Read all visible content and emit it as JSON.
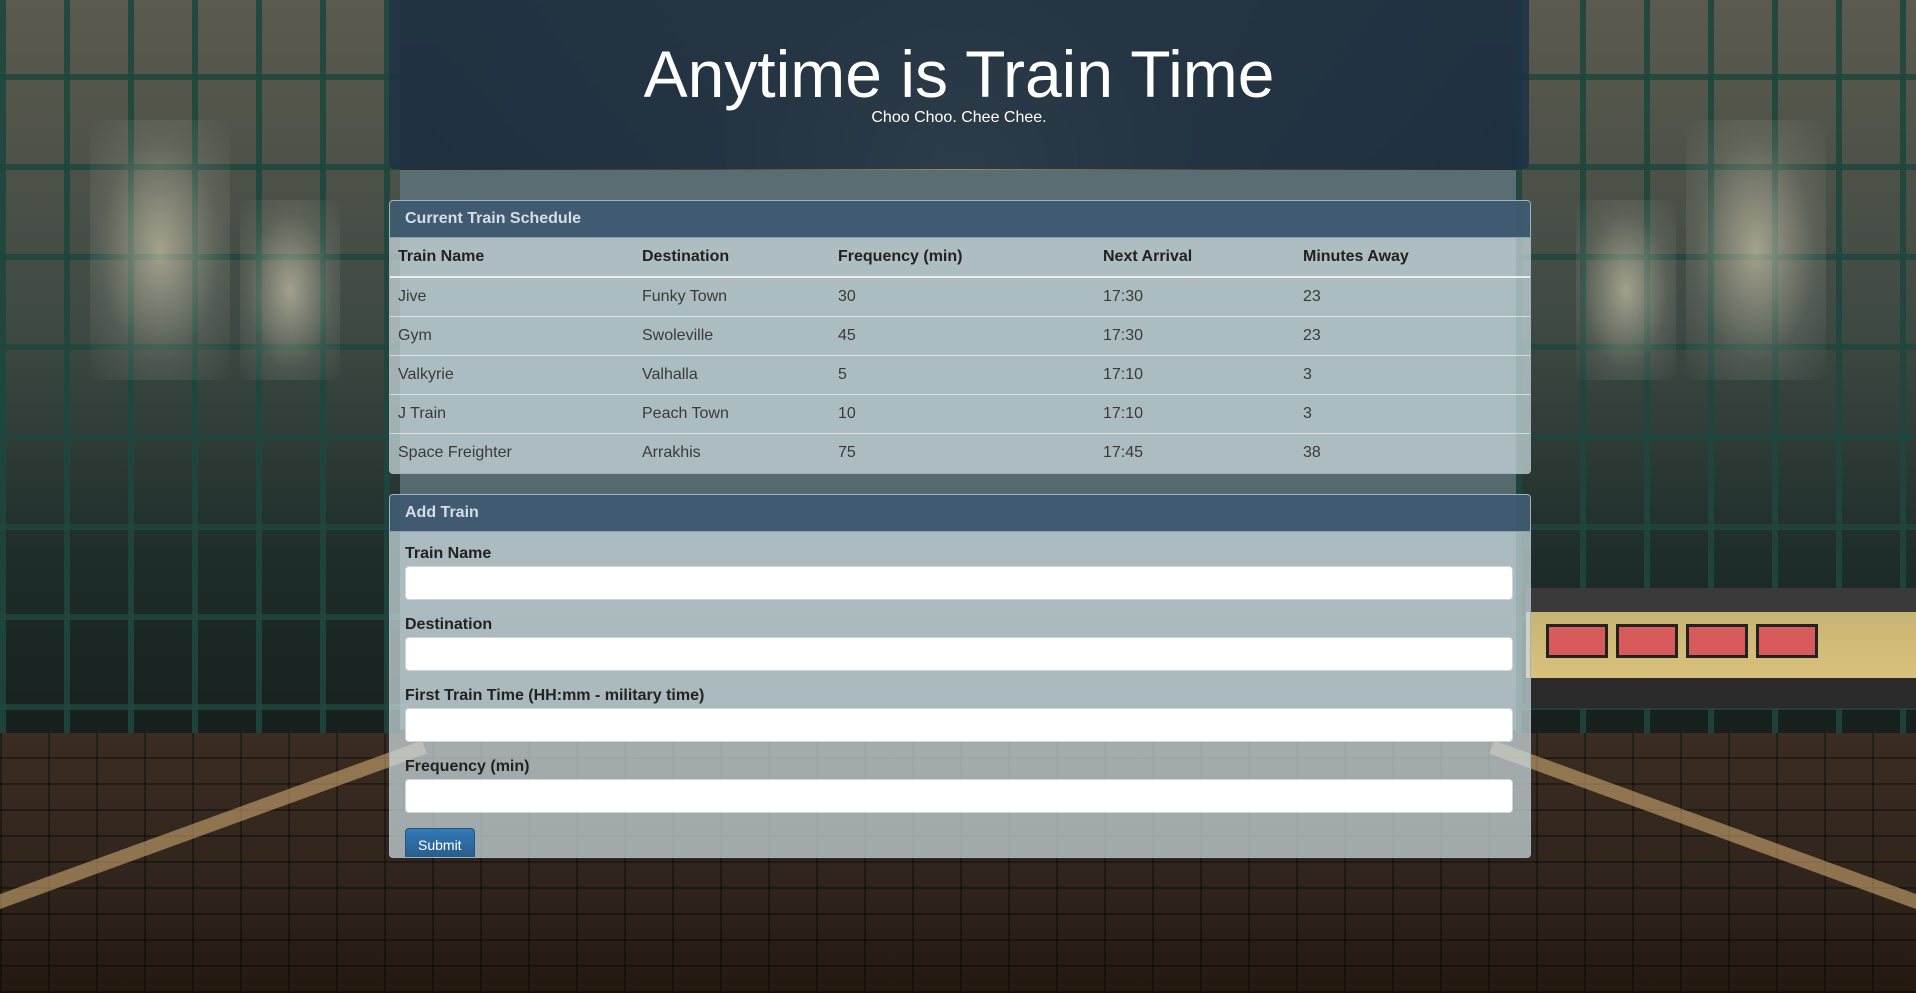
{
  "header": {
    "title": "Anytime is Train Time",
    "subtitle": "Choo Choo. Chee Chee."
  },
  "schedule": {
    "heading": "Current Train Schedule",
    "columns": [
      "Train Name",
      "Destination",
      "Frequency (min)",
      "Next Arrival",
      "Minutes Away"
    ],
    "rows": [
      [
        "Jive",
        "Funky Town",
        "30",
        "17:30",
        "23"
      ],
      [
        "Gym",
        "Swoleville",
        "45",
        "17:30",
        "23"
      ],
      [
        "Valkyrie",
        "Valhalla",
        "5",
        "17:10",
        "3"
      ],
      [
        "J Train",
        "Peach Town",
        "10",
        "17:10",
        "3"
      ],
      [
        "Space Freighter",
        "Arrakhis",
        "75",
        "17:45",
        "38"
      ]
    ]
  },
  "add_train": {
    "heading": "Add Train",
    "fields": {
      "train_name": {
        "label": "Train Name",
        "value": ""
      },
      "destination": {
        "label": "Destination",
        "value": ""
      },
      "first_time": {
        "label": "First Train Time (HH:mm - military time)",
        "value": ""
      },
      "frequency": {
        "label": "Frequency (min)",
        "value": ""
      }
    },
    "submit_label": "Submit"
  },
  "colors": {
    "header_bg": "#1d3145",
    "panel_heading_bg": "#28465f",
    "button_primary": "#337ab7"
  }
}
